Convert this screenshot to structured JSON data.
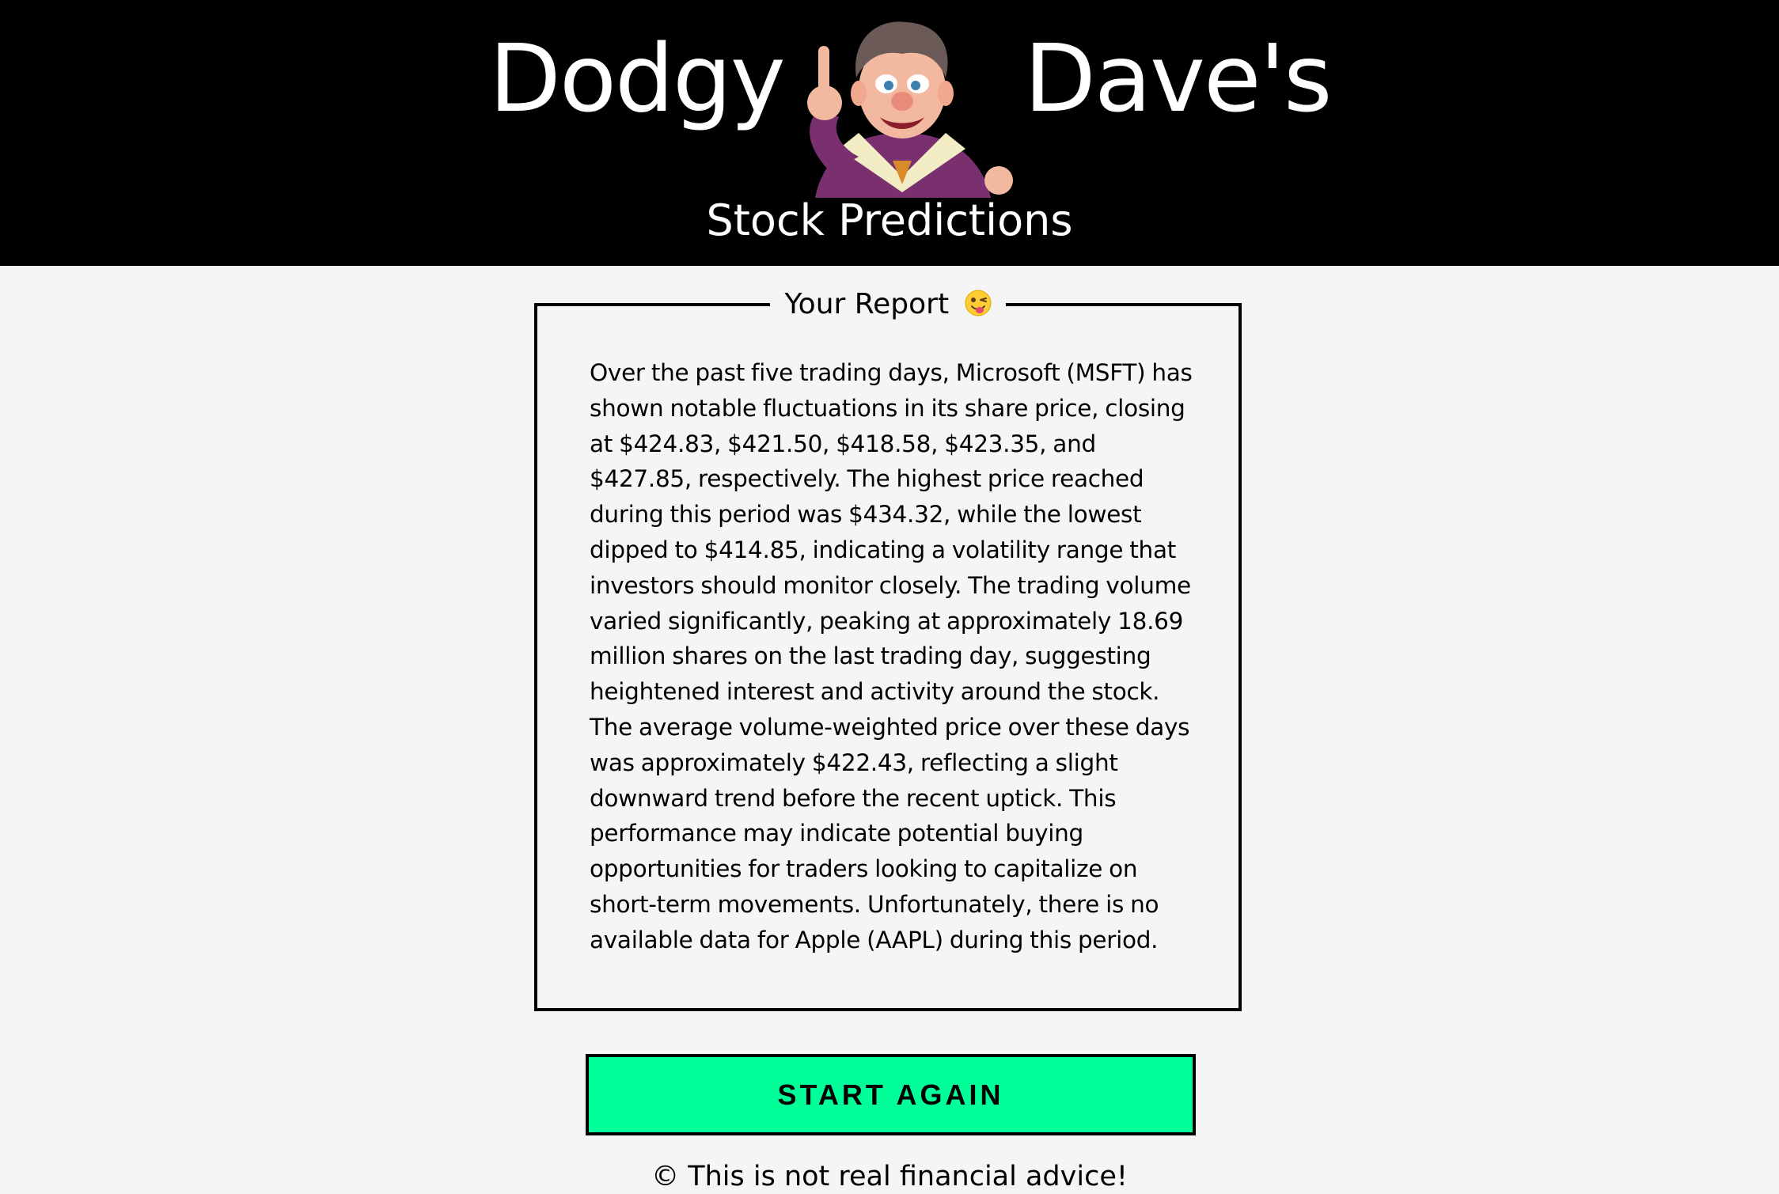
{
  "header": {
    "brand_left": "Dodgy",
    "brand_right": "Dave's",
    "subtitle": "Stock Predictions",
    "mascot_icon": "cartoon-mascot-pointing",
    "background": "#000000"
  },
  "report": {
    "title": "Your Report",
    "title_icon": "winking-face-with-tongue-emoji",
    "text": "Over the past five trading days, Microsoft (MSFT) has shown notable fluctuations in its share price, closing at $424.83, $421.50, $418.58, $423.35, and $427.85, respectively. The highest price reached during this period was $434.32, while the lowest dipped to $414.85, indicating a volatility range that investors should monitor closely. The trading volume varied significantly, peaking at approximately 18.69 million shares on the last trading day, suggesting heightened interest and activity around the stock. The average volume-weighted price over these days was approximately $422.43, reflecting a slight downward trend before the recent uptick. This performance may indicate potential buying opportunities for traders looking to capitalize on short-term movements. Unfortunately, there is no available data for Apple (AAPL) during this period."
  },
  "actions": {
    "start_again_label": "START AGAIN",
    "button_color": "#00ff99"
  },
  "footer": {
    "disclaimer": "© This is not real financial advice!"
  }
}
